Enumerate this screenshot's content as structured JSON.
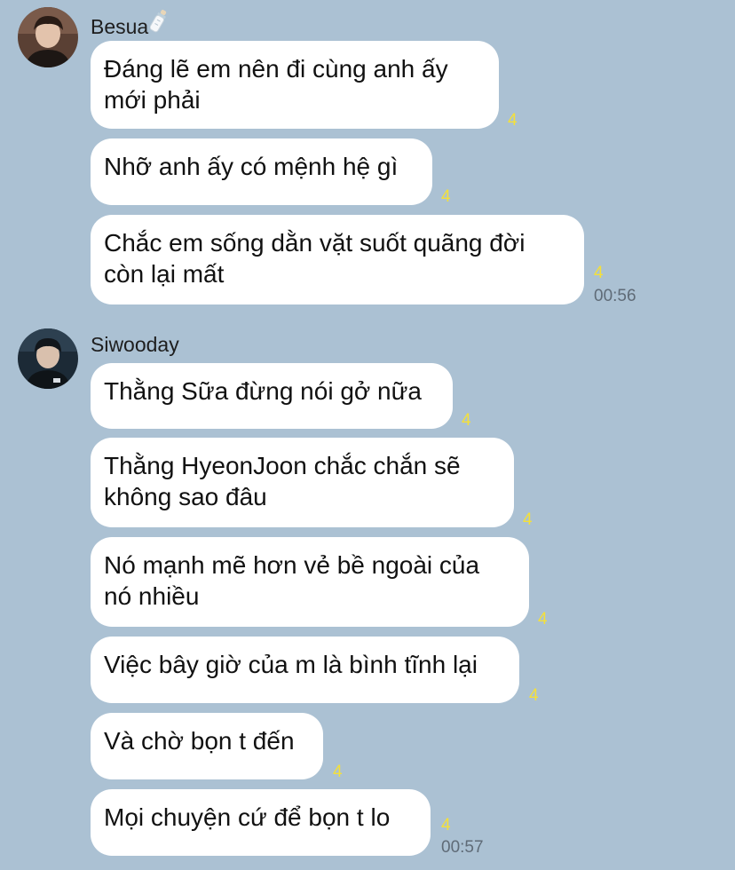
{
  "groups": [
    {
      "sender": "Besua",
      "avatar_icon": "profile-photo-icon",
      "name_emoji_icon": "baby-bottle-icon",
      "time": "00:56",
      "messages": [
        {
          "text": "Đáng lẽ em nên đi cùng anh ấy\nmới phải",
          "unread": "4"
        },
        {
          "text": "Nhỡ anh ấy có mệnh hệ gì",
          "unread": "4"
        },
        {
          "text": "Chắc em sống dằn vặt suốt quãng đời\ncòn lại mất",
          "unread": "4"
        }
      ]
    },
    {
      "sender": "Siwooday",
      "avatar_icon": "profile-photo-icon",
      "time": "00:57",
      "messages": [
        {
          "text": "Thằng Sữa đừng nói gở nữa",
          "unread": "4"
        },
        {
          "text": "Thằng HyeonJoon chắc chắn sẽ\nkhông sao đâu",
          "unread": "4"
        },
        {
          "text": "Nó mạnh mẽ hơn vẻ bề ngoài của\nnó nhiều",
          "unread": "4"
        },
        {
          "text": "Việc bây giờ của m là bình tĩnh lại",
          "unread": "4"
        },
        {
          "text": "Và chờ bọn t đến",
          "unread": "4"
        },
        {
          "text": "Mọi chuyện cứ để bọn t lo",
          "unread": "4"
        }
      ]
    }
  ],
  "colors": {
    "background": "#abc1d3",
    "bubble": "#ffffff",
    "unread_count": "#f4e03a",
    "timestamp": "#5f6b77"
  }
}
